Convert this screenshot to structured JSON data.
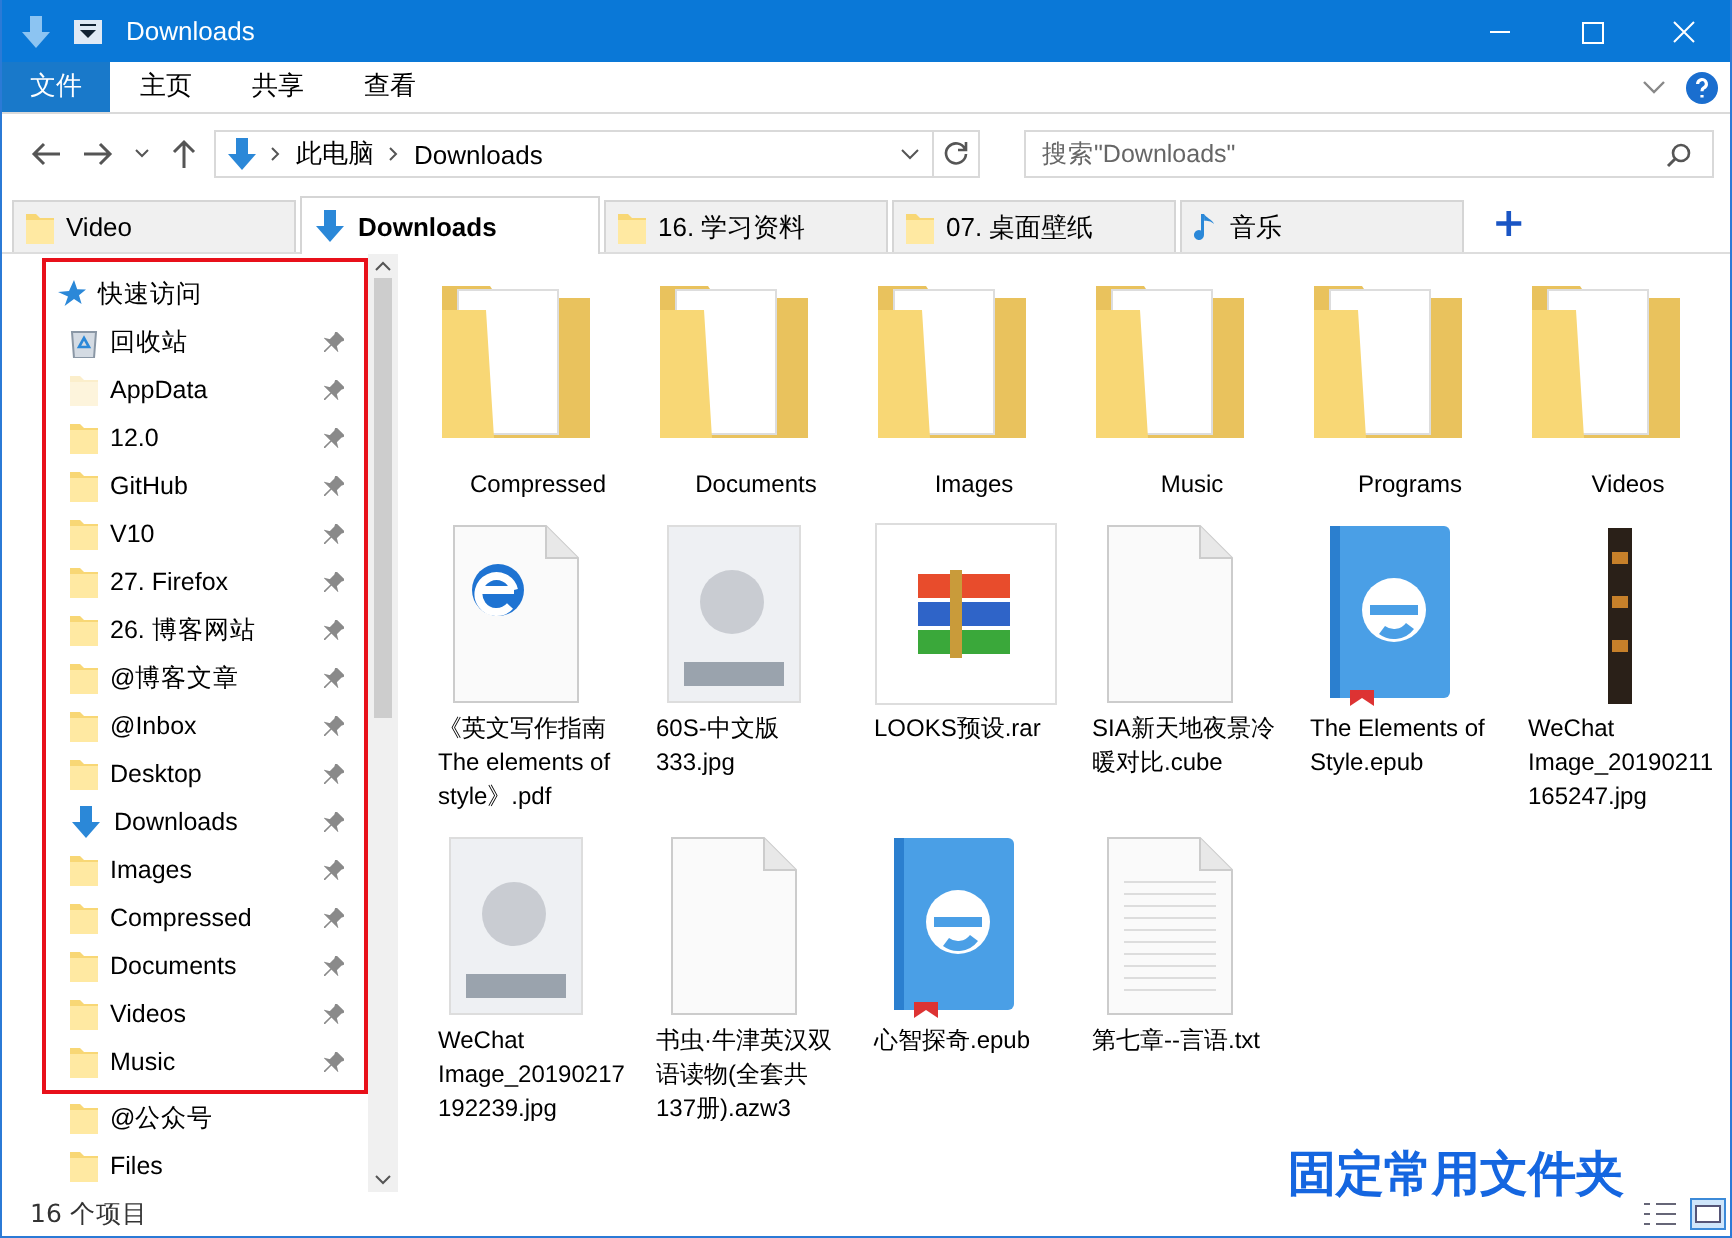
{
  "window": {
    "title": "Downloads"
  },
  "ribbon_tabs": [
    {
      "label": "文件",
      "selected": true
    },
    {
      "label": "主页",
      "selected": false
    },
    {
      "label": "共享",
      "selected": false
    },
    {
      "label": "查看",
      "selected": false
    }
  ],
  "address": {
    "path": [
      "此电脑",
      "Downloads"
    ]
  },
  "search": {
    "placeholder": "搜索\"Downloads\""
  },
  "tabs": [
    {
      "label": "Video",
      "kind": "folder",
      "selected": false
    },
    {
      "label": "Downloads",
      "kind": "download",
      "selected": true
    },
    {
      "label": "16. 学习资料",
      "kind": "folder",
      "selected": false
    },
    {
      "label": "07. 桌面壁纸",
      "kind": "folder",
      "selected": false
    },
    {
      "label": "音乐",
      "kind": "music",
      "selected": false
    }
  ],
  "new_tab": {
    "label": "+"
  },
  "sidebar": {
    "header": "快速访问",
    "items": [
      {
        "label": "回收站",
        "kind": "recycle",
        "pinned": true,
        "hidden": false
      },
      {
        "label": "AppData",
        "kind": "folder",
        "pinned": true,
        "hidden": true
      },
      {
        "label": "12.0",
        "kind": "folder",
        "pinned": true,
        "hidden": false
      },
      {
        "label": "GitHub",
        "kind": "folder",
        "pinned": true,
        "hidden": false
      },
      {
        "label": "V10",
        "kind": "folder",
        "pinned": true,
        "hidden": false
      },
      {
        "label": "27. Firefox",
        "kind": "folder",
        "pinned": true,
        "hidden": false
      },
      {
        "label": "26. 博客网站",
        "kind": "folder",
        "pinned": true,
        "hidden": false
      },
      {
        "label": "@博客文章",
        "kind": "folder",
        "pinned": true,
        "hidden": false
      },
      {
        "label": "@Inbox",
        "kind": "folder",
        "pinned": true,
        "hidden": false
      },
      {
        "label": "Desktop",
        "kind": "folder",
        "pinned": true,
        "hidden": false
      },
      {
        "label": "Downloads",
        "kind": "download",
        "pinned": true,
        "hidden": false
      },
      {
        "label": "Images",
        "kind": "folder",
        "pinned": true,
        "hidden": false
      },
      {
        "label": "Compressed",
        "kind": "folder",
        "pinned": true,
        "hidden": false
      },
      {
        "label": "Documents",
        "kind": "folder",
        "pinned": true,
        "hidden": false
      },
      {
        "label": "Videos",
        "kind": "folder",
        "pinned": true,
        "hidden": false
      },
      {
        "label": "Music",
        "kind": "folder",
        "pinned": true,
        "hidden": false
      },
      {
        "label": "@公众号",
        "kind": "folder",
        "pinned": false,
        "hidden": false
      },
      {
        "label": "Files",
        "kind": "folder",
        "pinned": false,
        "hidden": false
      }
    ]
  },
  "files": [
    {
      "name": "Compressed",
      "kind": "folder"
    },
    {
      "name": "Documents",
      "kind": "folder"
    },
    {
      "name": "Images",
      "kind": "folder"
    },
    {
      "name": "Music",
      "kind": "folder"
    },
    {
      "name": "Programs",
      "kind": "folder"
    },
    {
      "name": "Videos",
      "kind": "folder"
    },
    {
      "name": "《英文写作指南 The elements of style》.pdf",
      "kind": "pdf"
    },
    {
      "name": "60S-中文版333.jpg",
      "kind": "image"
    },
    {
      "name": "LOOKS预设.rar",
      "kind": "archive"
    },
    {
      "name": "SIA新天地夜景冷暖对比.cube",
      "kind": "blank"
    },
    {
      "name": "The Elements of Style.epub",
      "kind": "epub"
    },
    {
      "name": "WeChat Image_20190211165247.jpg",
      "kind": "strip"
    },
    {
      "name": "WeChat Image_20190217192239.jpg",
      "kind": "image"
    },
    {
      "name": "书虫·牛津英汉双语读物(全套共137册).azw3",
      "kind": "blank"
    },
    {
      "name": "心智探奇.epub",
      "kind": "epub"
    },
    {
      "name": "第七章--言语.txt",
      "kind": "text"
    }
  ],
  "caption": "固定常用文件夹",
  "status_bar": {
    "count": "16 个项目"
  }
}
